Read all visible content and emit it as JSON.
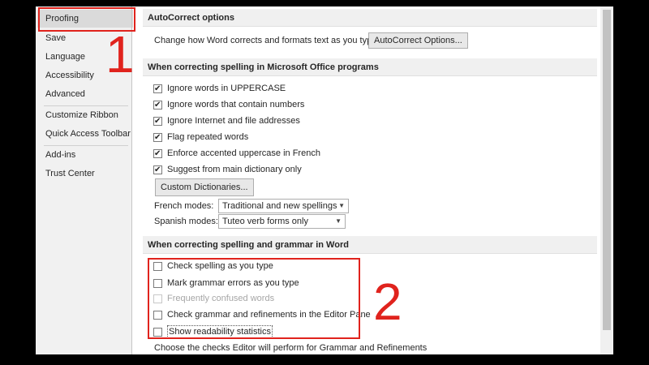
{
  "sidebar": {
    "items": [
      {
        "label": "Proofing"
      },
      {
        "label": "Save"
      },
      {
        "label": "Language"
      },
      {
        "label": "Accessibility"
      },
      {
        "label": "Advanced"
      },
      {
        "label": "Customize Ribbon"
      },
      {
        "label": "Quick Access Toolbar"
      },
      {
        "label": "Add-ins"
      },
      {
        "label": "Trust Center"
      }
    ]
  },
  "autocorrect": {
    "header": "AutoCorrect options",
    "description": "Change how Word corrects and formats text as you type:",
    "button_label": "AutoCorrect Options..."
  },
  "office_spelling": {
    "header": "When correcting spelling in Microsoft Office programs",
    "options": [
      {
        "label": "Ignore words in UPPERCASE",
        "checked": true
      },
      {
        "label": "Ignore words that contain numbers",
        "checked": true
      },
      {
        "label": "Ignore Internet and file addresses",
        "checked": true
      },
      {
        "label": "Flag repeated words",
        "checked": true
      },
      {
        "label": "Enforce accented uppercase in French",
        "checked": true
      },
      {
        "label": "Suggest from main dictionary only",
        "checked": true
      }
    ],
    "custom_dict_button": "Custom Dictionaries...",
    "french_modes_label": "French modes:",
    "french_modes_value": "Traditional and new spellings",
    "spanish_modes_label": "Spanish modes:",
    "spanish_modes_value": "Tuteo verb forms only"
  },
  "word_spelling": {
    "header": "When correcting spelling and grammar in Word",
    "options": [
      {
        "label": "Check spelling as you type",
        "checked": false,
        "disabled": false
      },
      {
        "label": "Mark grammar errors as you type",
        "checked": false,
        "disabled": false
      },
      {
        "label": "Frequently confused words",
        "checked": false,
        "disabled": true
      },
      {
        "label": "Check grammar and refinements in the Editor Pane",
        "checked": false,
        "disabled": false
      },
      {
        "label": "Show readability statistics",
        "checked": false,
        "disabled": false
      }
    ],
    "footer_text": "Choose the checks Editor will perform for Grammar and Refinements"
  },
  "annotations": {
    "one": "1",
    "two": "2",
    "color": "#e0231d"
  }
}
